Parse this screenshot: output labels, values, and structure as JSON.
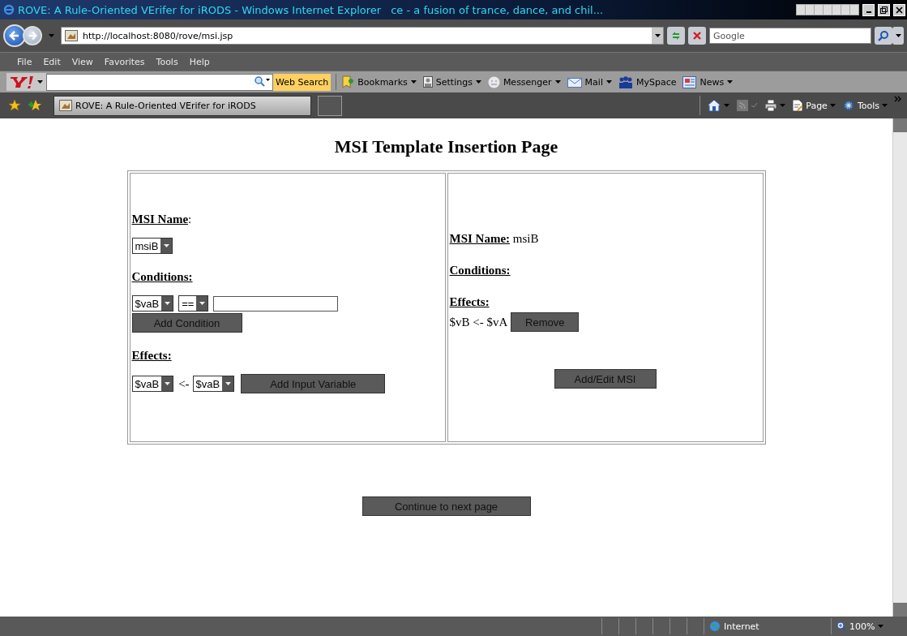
{
  "window": {
    "title": "ROVE: A Rule-Oriented VErifer for iRODS - Windows Internet Explorer",
    "ticker": "ce - a fusion of trance, dance, and chil..."
  },
  "address_bar": {
    "url": "http://localhost:8080/rove/msi.jsp",
    "search_placeholder": "Google"
  },
  "menu": [
    "File",
    "Edit",
    "View",
    "Favorites",
    "Tools",
    "Help"
  ],
  "toolbar": {
    "search_button": "Web Search",
    "items": [
      {
        "kind": "bookmarks",
        "label": "Bookmarks"
      },
      {
        "kind": "settings",
        "label": "Settings"
      },
      {
        "kind": "messenger",
        "label": "Messenger"
      },
      {
        "kind": "mail",
        "label": "Mail"
      },
      {
        "kind": "myspace",
        "label": "MySpace"
      },
      {
        "kind": "news",
        "label": "News"
      }
    ]
  },
  "tab": {
    "title": "ROVE: A Rule-Oriented VErifer for iRODS"
  },
  "command_bar": {
    "page": "Page",
    "tools": "Tools"
  },
  "page": {
    "heading": "MSI Template Insertion Page",
    "left": {
      "name_label": "**MSI Name**:",
      "name_value": "msiB",
      "conditions_label": "Conditions:",
      "condition": {
        "variable": "$vaB",
        "operator": "==",
        "button": "Add Condition"
      },
      "effects_label": "Effects:",
      "effect": {
        "target": "$vaB",
        "arrow": "<-",
        "source": "$vaB",
        "button": "Add Input Variable"
      }
    },
    "right": {
      "name_label": "MSI Name:",
      "name_value": "msiB",
      "conditions_label": "Conditions:",
      "effects_label": "Effects:",
      "effects": [
        {
          "text": "$vB <- $vA",
          "button": "Remove"
        }
      ],
      "submit": "Add/Edit MSI"
    },
    "continue": "Continue to next page"
  },
  "status_bar": {
    "zone": "Internet",
    "zoom": "100%"
  }
}
